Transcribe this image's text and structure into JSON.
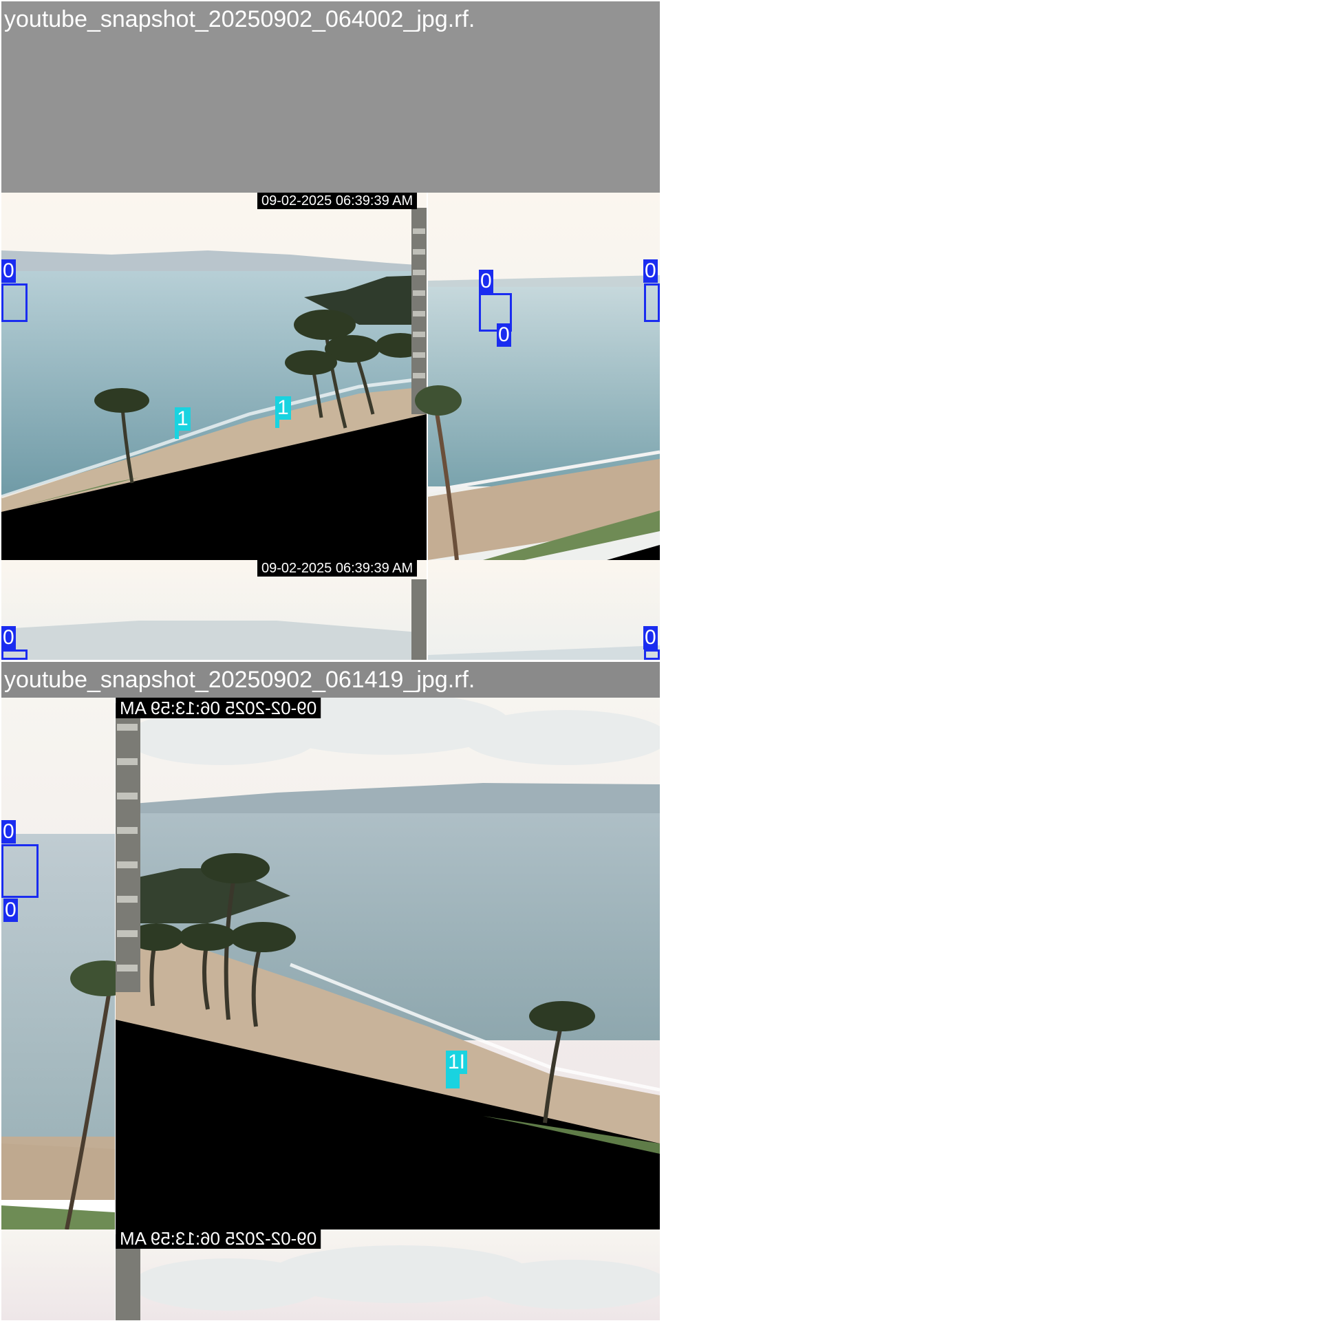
{
  "tiles": [
    {
      "filename": "youtube_snapshot_20250902_064002_jpg.rf.",
      "timestamp": "09-02-2025 06:39:39 AM",
      "timestamp_repeat": "09-02-2025 06:39:39 AM",
      "boat_label": "0",
      "person_label": "1"
    },
    {
      "filename": "youtube_snapshot_20250902_061419_jpg.rf.",
      "timestamp": "09-02-2025 06:13:59 AM",
      "timestamp_repeat": "09-02-2025 06:13:59 AM",
      "boat_label": "0",
      "person_label": "1",
      "person_label_2": "1I"
    }
  ],
  "colors": {
    "boat_box": "#1a2cf0",
    "person_box": "#19d3e0",
    "header_bg": "#8e8e8e"
  }
}
